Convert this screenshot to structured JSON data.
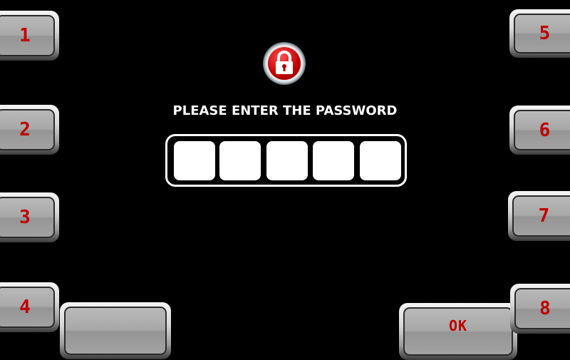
{
  "prompt": "PLEASE ENTER THE PASSWORD",
  "lock_icon": "padlock-icon",
  "password_slots": 5,
  "password_values": [
    "",
    "",
    "",
    "",
    ""
  ],
  "keys": {
    "k1": "1",
    "k2": "2",
    "k3": "3",
    "k4": "4",
    "k5": "5",
    "k6": "6",
    "k7": "7",
    "k8": "8",
    "ok": "OK",
    "blank": ""
  },
  "colors": {
    "digit": "#c00000",
    "background": "#000000"
  }
}
